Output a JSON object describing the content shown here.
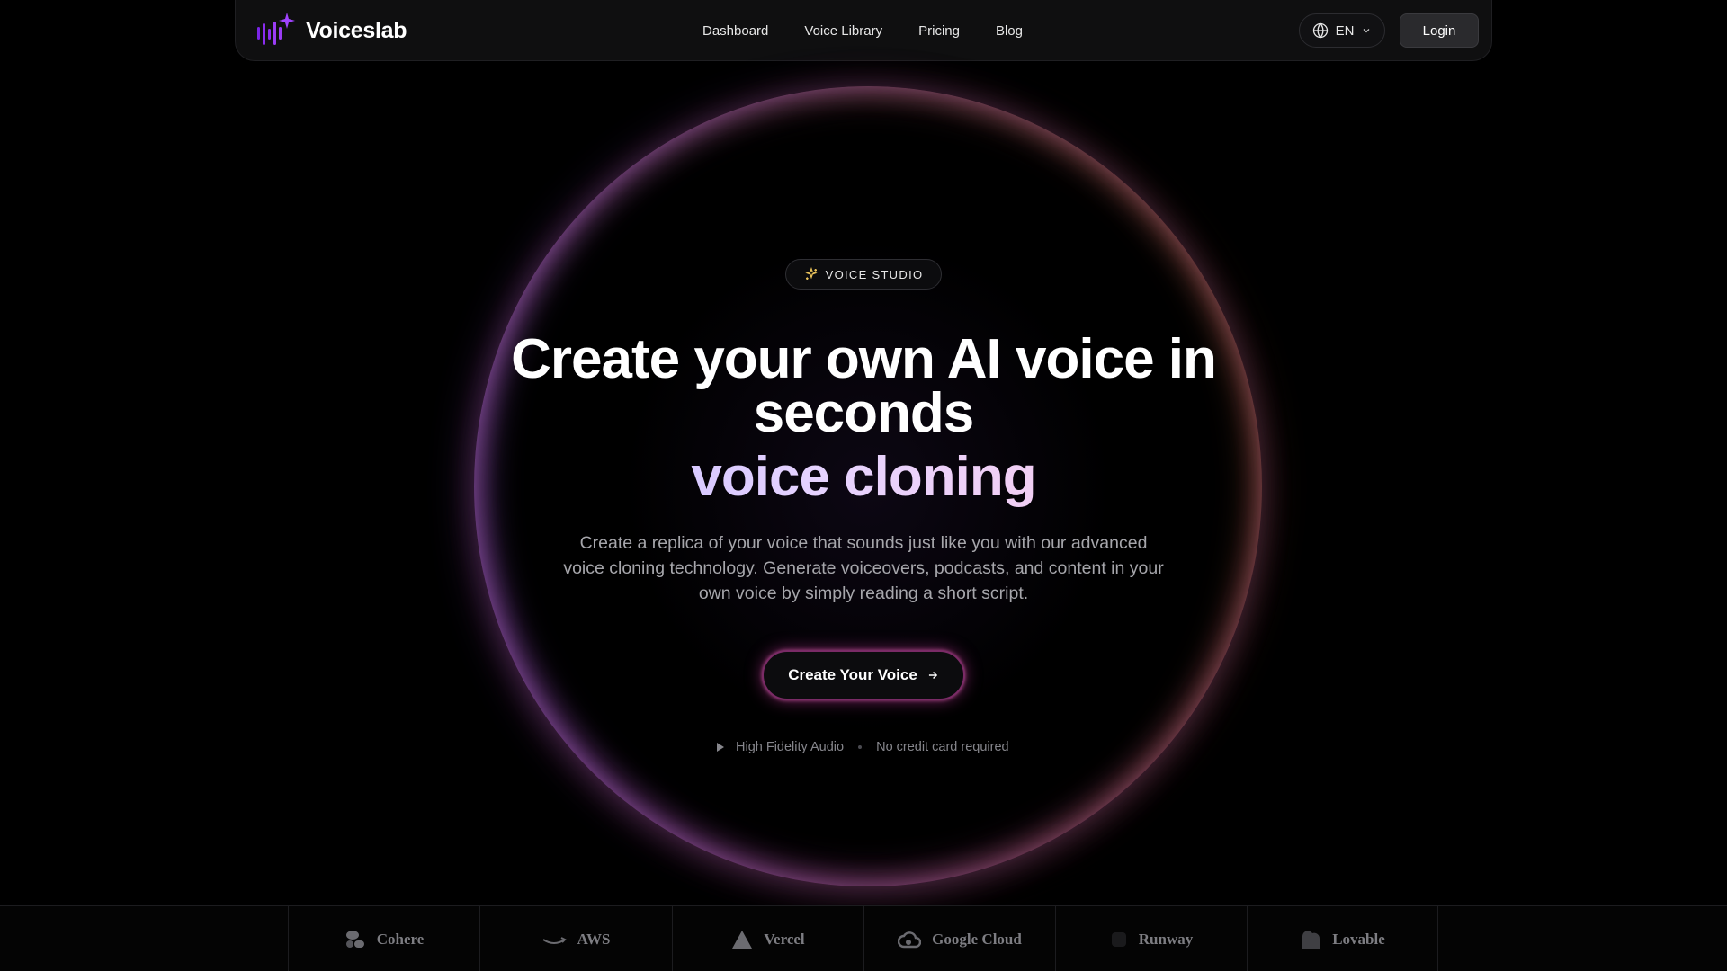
{
  "brand": {
    "name": "Voiceslab",
    "accent": "#8b2cf0"
  },
  "nav": {
    "links": [
      "Dashboard",
      "Voice Library",
      "Pricing",
      "Blog"
    ],
    "language": "EN",
    "login_label": "Login"
  },
  "hero": {
    "badge": "VOICE STUDIO",
    "headline_line1": "Create your own AI voice in",
    "headline_line2": "seconds",
    "headline_accent": "voice cloning",
    "subtitle": "Create a replica of your voice that sounds just like you with our advanced voice cloning technology. Generate voiceovers, podcasts, and content in your own voice by simply reading a short script.",
    "cta_label": "Create Your Voice",
    "meta": [
      "High Fidelity Audio",
      "No credit card required"
    ]
  },
  "partners": [
    "Cohere",
    "AWS",
    "Vercel",
    "Google Cloud",
    "Runway",
    "Lovable"
  ]
}
